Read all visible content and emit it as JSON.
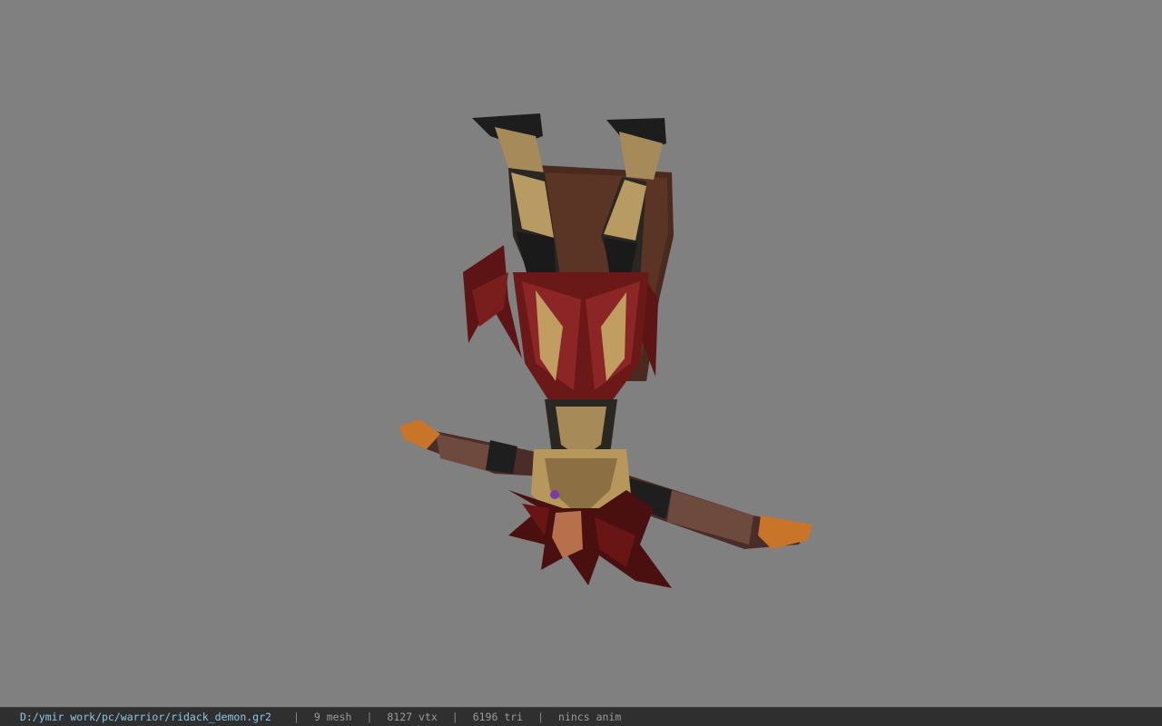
{
  "status_bar": {
    "file_path": "D:/ymir work/pc/warrior/ridack_demon.gr2",
    "separator": "|",
    "mesh_count": "9 mesh",
    "vertex_count": "8127 vtx",
    "triangle_count": "6196 tri",
    "animation": "nincs anim"
  },
  "colors": {
    "viewport_background": "#808080",
    "status_background": "#2f2f2f",
    "path_text": "#8fc6e6",
    "status_text": "#9a9a9a"
  }
}
